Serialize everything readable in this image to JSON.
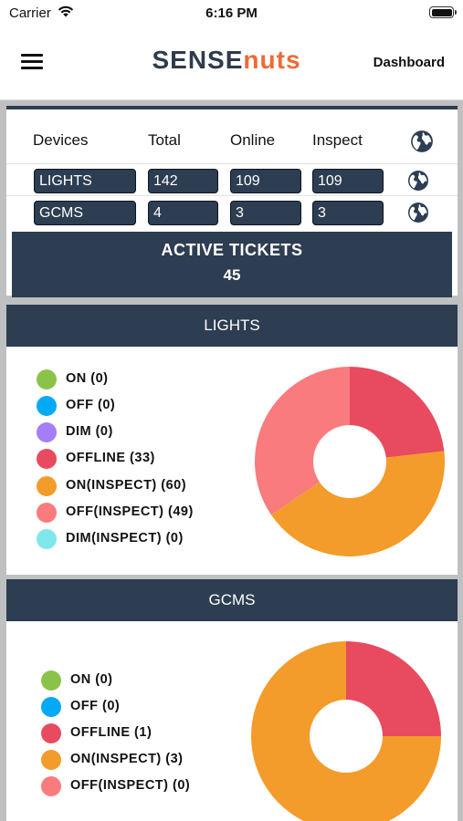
{
  "status_bar": {
    "carrier": "Carrier",
    "time": "6:16 PM"
  },
  "nav": {
    "menu_icon": "hamburger-menu-icon",
    "logo_part1": "SENSE",
    "logo_part2": "nuts",
    "dashboard_label": "Dashboard",
    "colors": {
      "logo_dark": "#2f3b4c",
      "logo_accent": "#ee6a35"
    }
  },
  "summary": {
    "headers": [
      "Devices",
      "Total",
      "Online",
      "Inspect"
    ],
    "header_icon": "globe-icon",
    "rows": [
      {
        "device": "LIGHTS",
        "total": "142",
        "online": "109",
        "inspect": "109",
        "icon": "globe-icon"
      },
      {
        "device": "GCMS",
        "total": "4",
        "online": "3",
        "inspect": "3",
        "icon": "globe-icon"
      }
    ],
    "tickets_label": "ACTIVE TICKETS",
    "tickets_count": "45",
    "colors": {
      "panel": "#2d3d52"
    }
  },
  "lights_card": {
    "title": "LIGHTS",
    "legend": [
      {
        "label": "ON (0)",
        "color": "#8bc34a"
      },
      {
        "label": "OFF (0)",
        "color": "#03a9f4"
      },
      {
        "label": "DIM (0)",
        "color": "#a57ef5"
      },
      {
        "label": "OFFLINE (33)",
        "color": "#e84a5f"
      },
      {
        "label": "ON(INSPECT) (60)",
        "color": "#f39c2b"
      },
      {
        "label": "OFF(INSPECT) (49)",
        "color": "#f97b7d"
      },
      {
        "label": "DIM(INSPECT) (0)",
        "color": "#7ee8ec"
      }
    ]
  },
  "gcms_card": {
    "title": "GCMS",
    "legend": [
      {
        "label": "ON (0)",
        "color": "#8bc34a"
      },
      {
        "label": "OFF (0)",
        "color": "#03a9f4"
      },
      {
        "label": "OFFLINE (1)",
        "color": "#e84a5f"
      },
      {
        "label": "ON(INSPECT) (3)",
        "color": "#f39c2b"
      },
      {
        "label": "OFF(INSPECT) (0)",
        "color": "#f97b7d"
      }
    ]
  },
  "chart_data": [
    {
      "type": "pie",
      "title": "LIGHTS",
      "categories": [
        "ON",
        "OFF",
        "DIM",
        "OFFLINE",
        "ON(INSPECT)",
        "OFF(INSPECT)",
        "DIM(INSPECT)"
      ],
      "values": [
        0,
        0,
        0,
        33,
        60,
        49,
        0
      ],
      "colors": [
        "#8bc34a",
        "#03a9f4",
        "#a57ef5",
        "#e84a5f",
        "#f39c2b",
        "#f97b7d",
        "#7ee8ec"
      ],
      "legend": "left",
      "donut": true
    },
    {
      "type": "pie",
      "title": "GCMS",
      "categories": [
        "ON",
        "OFF",
        "OFFLINE",
        "ON(INSPECT)",
        "OFF(INSPECT)"
      ],
      "values": [
        0,
        0,
        1,
        3,
        0
      ],
      "colors": [
        "#8bc34a",
        "#03a9f4",
        "#e84a5f",
        "#f39c2b",
        "#f97b7d"
      ],
      "legend": "left",
      "donut": true
    }
  ]
}
